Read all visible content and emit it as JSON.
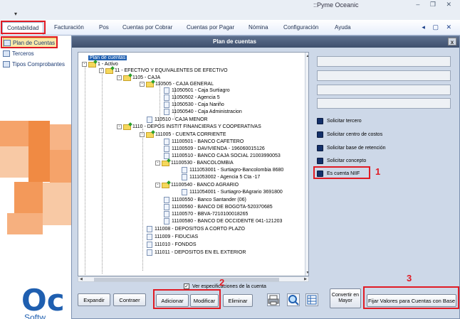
{
  "app": {
    "title": "::Pyme Oceanic",
    "quick_access_arrow": "▾",
    "window_controls": "‒ ❐ ✕"
  },
  "menu": {
    "items": [
      "Contabilidad",
      "Facturación",
      "Pos",
      "Cuentas por Cobrar",
      "Cuentas por Pagar",
      "Nómina",
      "Configuración",
      "Ayuda"
    ],
    "active": "Contabilidad",
    "right_controls": "◂ ▢ ✕"
  },
  "sidebar": {
    "items": [
      {
        "label": "Plan de Cuentas",
        "selected": true
      },
      {
        "label": "Terceros",
        "selected": false
      },
      {
        "label": "Tipos Comprobantes",
        "selected": false
      }
    ]
  },
  "background": {
    "logo_text": "Oc",
    "logo_sub": "Softw"
  },
  "dialog": {
    "title": "Plan de cuentas",
    "close": "x",
    "tree": [
      {
        "label": "Plan de cuentas",
        "kind": "root"
      },
      {
        "label": "1 - Activo",
        "kind": "folder"
      },
      {
        "label": "11 - EFECTIVO Y EQUIVALENTES DE EFECTIVO",
        "kind": "folder"
      },
      {
        "label": "1105 - CAJA",
        "kind": "folder"
      },
      {
        "label": "110505 - CAJA GENERAL",
        "kind": "folder"
      },
      {
        "label": "11050501 - Caja Surtiagro",
        "kind": "doc"
      },
      {
        "label": "11050502 - Agencia 5",
        "kind": "doc"
      },
      {
        "label": "11050530 - Caja Nariño",
        "kind": "doc"
      },
      {
        "label": "11050540 - Caja Administracion",
        "kind": "doc"
      },
      {
        "label": "110510 - CAJA MENOR",
        "kind": "doc"
      },
      {
        "label": "1110 - DEPOS INSTIT FINANCIERAS Y  COOPERATIVAS",
        "kind": "folder"
      },
      {
        "label": "111005 - CUENTA CORRIENTE",
        "kind": "folder"
      },
      {
        "label": "11100501 - BANCO CAFETERO",
        "kind": "doc"
      },
      {
        "label": "11100509 - DAVIVIENDA - 196060015126",
        "kind": "doc"
      },
      {
        "label": "11100510 - BANCO CAJA SOCIAL 21003990053",
        "kind": "doc"
      },
      {
        "label": "11100530 - BANCOLOMBIA",
        "kind": "folder"
      },
      {
        "label": "1111053001 - Surtiagro-Bancolombia 8680",
        "kind": "doc"
      },
      {
        "label": "1111053002 - Agencia 5 Cta -17",
        "kind": "doc"
      },
      {
        "label": "11100540 - BANCO AGRARIO",
        "kind": "folder"
      },
      {
        "label": "1111054001 - Surtiagro-BAgrario 3691800",
        "kind": "doc"
      },
      {
        "label": "11100550 - Banco Santander (06)",
        "kind": "doc"
      },
      {
        "label": "11100560 - BANCO DE BOGOTA-520370685",
        "kind": "doc"
      },
      {
        "label": "11100570 - BBVA-7210100018265",
        "kind": "doc"
      },
      {
        "label": "11100580 - BANCO DE OCCIDENTE 041-121203",
        "kind": "doc"
      },
      {
        "label": "111008 - DEPOSITOS A CORTO PLAZO",
        "kind": "doc"
      },
      {
        "label": "111009 - FIDUCIAS",
        "kind": "doc"
      },
      {
        "label": "111010 - FONDOS",
        "kind": "doc"
      },
      {
        "label": "111011 - DEPOSITOS EN EL EXTERIOR",
        "kind": "doc"
      }
    ],
    "options": [
      {
        "label": "Solicitar tercero"
      },
      {
        "label": "Solicitar centro de costos"
      },
      {
        "label": "Solicitar base de retención"
      },
      {
        "label": "Solicitar concepto"
      },
      {
        "label": "Es cuenta NIIF"
      }
    ],
    "ver_especificaciones": "Ver especificaciones de la cuenta",
    "buttons": {
      "expandir": "Expandir",
      "contraer": "Contraer",
      "adicionar": "Adicionar",
      "modificar": "Modificar",
      "eliminar": "Eliminar",
      "convertir": "Convertir en\nMayor",
      "fijar": "Fijar Valores para Cuentas con Base"
    }
  },
  "annotations": {
    "a1": "1",
    "a2": "2",
    "a3": "3"
  },
  "colors": {
    "annotation": "#e01b24",
    "title_bar": "#3e4f6d",
    "selection": "#1f5fb0"
  }
}
